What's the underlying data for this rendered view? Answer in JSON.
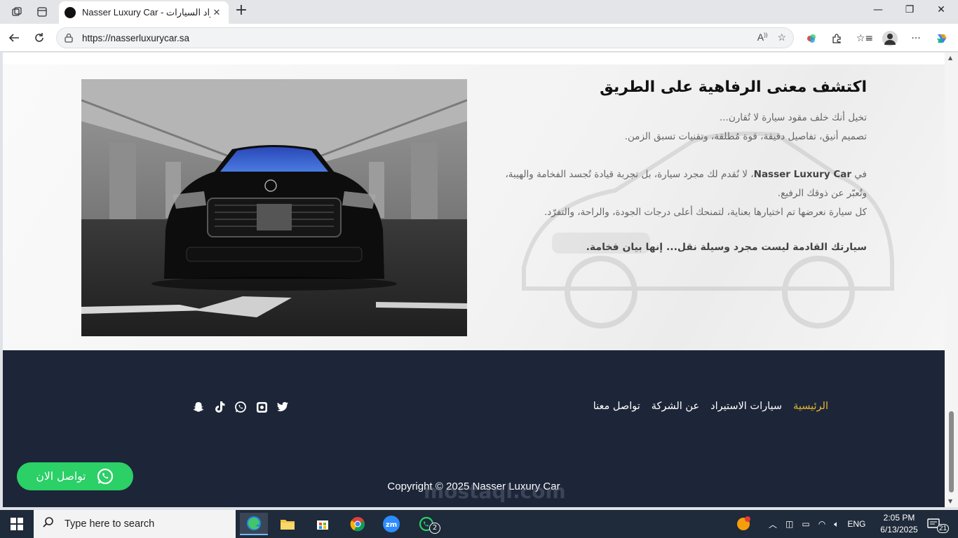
{
  "browser": {
    "tab_title": "Nasser Luxury Car - استيراد السيارات",
    "url": "https://nasserluxurycar.sa"
  },
  "hero": {
    "title": "اكتشف معنى الرفاهية على الطريق",
    "p1_line1": "تخيل أنك خلف مقود سيارة لا تُقارن...",
    "p1_line2": "تصميم أنيق، تفاصيل دقيقة، قوة مُطلقة، وتقنيات تسبق الزمن.",
    "p2_prefix": "في ",
    "p2_brand": "Nasser Luxury Car",
    "p2_line1_rest": "، لا نُقدم لك مجرد سيارة، بل تجربة قيادة تُجسد الفخامة والهيبة،",
    "p2_line2": "وتُعبّر عن ذوقك الرفيع.",
    "p2_line3": "كل سيارة نعرضها تم اختيارها بعناية، لتمنحك أعلى درجات الجودة، والراحة، والتفرّد.",
    "closing": "سيارتك القادمة ليست مجرد وسيلة نقل... إنها بيان فخامة."
  },
  "footer": {
    "nav": [
      "الرئيسية",
      "سيارات الاستيراد",
      "عن الشركة",
      "تواصل معنا"
    ],
    "social_icons": [
      "twitter-icon",
      "instagram-icon",
      "whatsapp-icon",
      "tiktok-icon",
      "snapchat-icon"
    ],
    "copyright": "Copyright © 2025 Nasser Luxury Car"
  },
  "whatsapp_button": {
    "label": "تواصل الان"
  },
  "watermark": "mostaql.com",
  "taskbar": {
    "search_placeholder": "Type here to search",
    "time": "2:05 PM",
    "date": "6/13/2025",
    "lang": "ENG",
    "notification_count": "21",
    "whatsapp_badge": "2"
  },
  "colors": {
    "footer_bg": "#1d2638",
    "nav_active": "#e5b331",
    "whatsapp_green": "#2bd066"
  }
}
